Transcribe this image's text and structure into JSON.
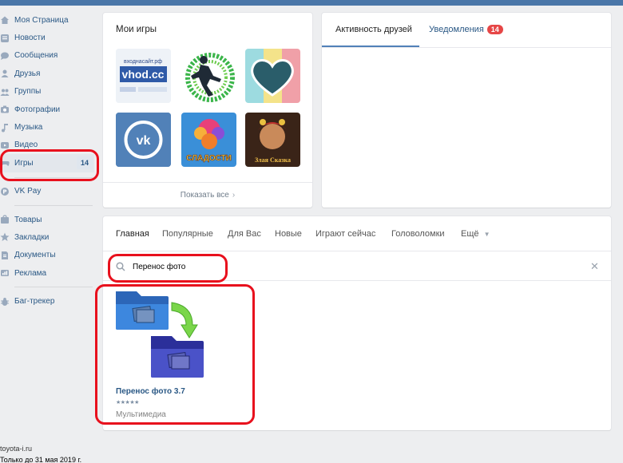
{
  "sidebar": {
    "items": [
      {
        "label": "Моя Страница",
        "icon": "home-icon"
      },
      {
        "label": "Новости",
        "icon": "news-icon"
      },
      {
        "label": "Сообщения",
        "icon": "messages-icon"
      },
      {
        "label": "Друзья",
        "icon": "friends-icon"
      },
      {
        "label": "Группы",
        "icon": "groups-icon"
      },
      {
        "label": "Фотографии",
        "icon": "camera-icon"
      },
      {
        "label": "Музыка",
        "icon": "music-icon"
      },
      {
        "label": "Видео",
        "icon": "video-icon"
      },
      {
        "label": "Игры",
        "icon": "gamepad-icon",
        "badge": "14"
      },
      {
        "label": "VK Pay",
        "icon": "vkpay-icon"
      },
      {
        "label": "Товары",
        "icon": "goods-icon"
      },
      {
        "label": "Закладки",
        "icon": "star-icon"
      },
      {
        "label": "Документы",
        "icon": "document-icon"
      },
      {
        "label": "Реклама",
        "icon": "ads-icon"
      },
      {
        "label": "Баг-трекер",
        "icon": "bug-icon"
      }
    ]
  },
  "games": {
    "title": "Мои игры",
    "more_label": "Показать все",
    "tiles": [
      {
        "name": "vhod-site-game",
        "caption": "входнасайт.рф",
        "logo_text": "vhod.cc"
      },
      {
        "name": "running-man-game"
      },
      {
        "name": "heart-game"
      },
      {
        "name": "vk-game"
      },
      {
        "name": "sweets-game",
        "caption": "СЛАДОСТИ"
      },
      {
        "name": "witch-game",
        "caption": "Злая Сказка"
      }
    ]
  },
  "activity": {
    "tab_friends": "Активность друзей",
    "tab_notifications": "Уведомления",
    "notifications_count": "14"
  },
  "catalog": {
    "tabs": [
      "Главная",
      "Популярные",
      "Для Вас",
      "Новые",
      "Играют сейчас",
      "Головоломки",
      "Ещё"
    ],
    "search_value": "Перенос фото",
    "app": {
      "title": "Перенос фото 3.7",
      "rating": "★★★★★",
      "category": "Мультимедиа"
    }
  },
  "footer": {
    "site": "toyota-i.ru",
    "note": "Только до 31 мая 2019 г."
  },
  "colors": {
    "accent": "#4a76a8",
    "link": "#2a5885",
    "badge_red": "#e64646",
    "annotation_red": "#e8101d"
  }
}
